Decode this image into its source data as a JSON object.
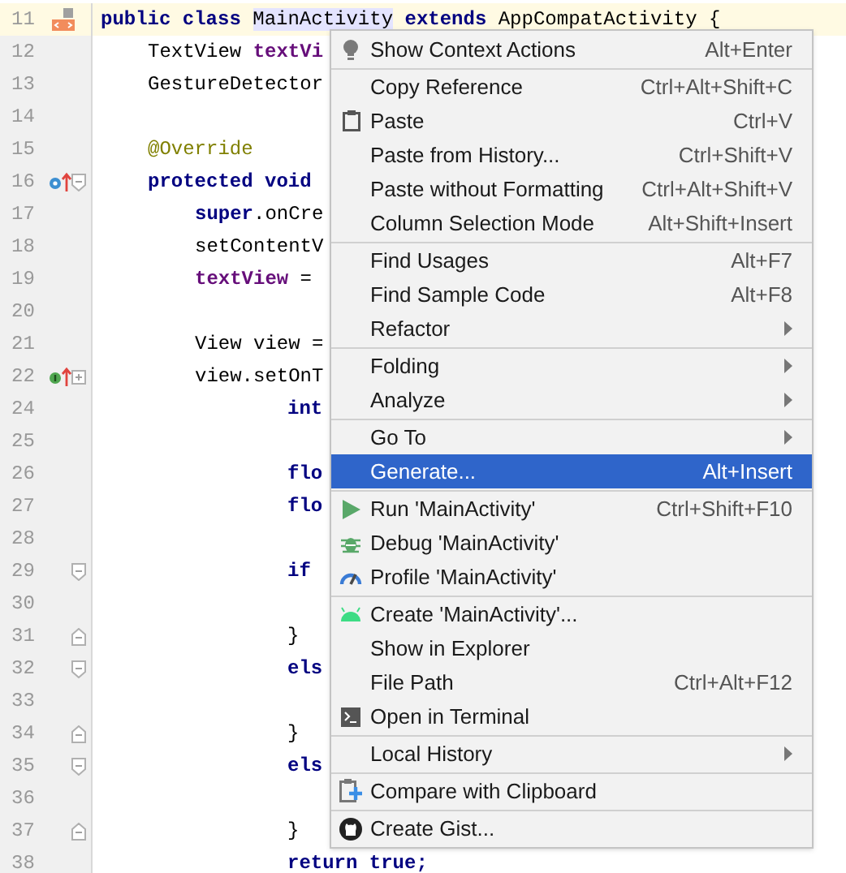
{
  "editor": {
    "lines": [
      {
        "number": "11",
        "current": true,
        "kind": "class",
        "segments": [
          {
            "text": "public class ",
            "kind": "keyword"
          },
          {
            "text": "MainActivity",
            "kind": "highlight"
          },
          {
            "text": " extends",
            "kind": "keyword"
          },
          {
            "text": " AppCompatActivity {",
            "kind": "plain"
          }
        ],
        "children": [
          {
            "number": "12",
            "current": false,
            "kind": "code",
            "segments": [
              {
                "text": "TextView ",
                "kind": "plain"
              },
              {
                "text": "textVi",
                "kind": "field"
              }
            ]
          },
          {
            "number": "13",
            "current": false,
            "kind": "code",
            "segments": [
              {
                "text": "GestureDetector",
                "kind": "plain"
              }
            ]
          },
          {
            "number": "14",
            "current": false,
            "kind": "code"
          },
          {
            "number": "15",
            "current": false,
            "kind": "code",
            "segments": [
              {
                "text": "@Override",
                "kind": "annotation"
              }
            ]
          },
          {
            "number": "16",
            "current": false,
            "kind": "override",
            "expanded": true,
            "segments": [
              {
                "text": "protected void",
                "kind": "keyword"
              }
            ],
            "children": [
              {
                "number": "17",
                "current": false,
                "kind": "code",
                "segments": [
                  {
                    "text": "super",
                    "kind": "keyword"
                  },
                  {
                    "text": ".onCre",
                    "kind": "plain"
                  }
                ]
              },
              {
                "number": "18",
                "current": false,
                "kind": "code",
                "segments": [
                  {
                    "text": "setContentV",
                    "kind": "plain"
                  }
                ]
              },
              {
                "number": "19",
                "current": false,
                "kind": "code",
                "segments": [
                  {
                    "text": "textView",
                    "kind": "field"
                  },
                  {
                    "text": " =",
                    "kind": "plain"
                  }
                ]
              },
              {
                "number": "20",
                "current": false,
                "kind": "code"
              },
              {
                "number": "21",
                "current": false,
                "kind": "code",
                "segments": [
                  {
                    "text": "View view =",
                    "kind": "plain"
                  }
                ]
              },
              {
                "number": "22",
                "current": false,
                "kind": "implement",
                "expanded": false,
                "segments": [
                  {
                    "text": "view.setOnT",
                    "kind": "plain"
                  }
                ],
                "children": [
                  {
                    "number": "24",
                    "current": false,
                    "kind": "code",
                    "segments": [
                      {
                        "text": "int",
                        "kind": "keyword"
                      }
                    ]
                  },
                  {
                    "number": "25",
                    "current": false,
                    "kind": "code"
                  },
                  {
                    "number": "26",
                    "current": false,
                    "kind": "code",
                    "segments": [
                      {
                        "text": "flo",
                        "kind": "keyword"
                      }
                    ]
                  },
                  {
                    "number": "27",
                    "current": false,
                    "kind": "code",
                    "segments": [
                      {
                        "text": "flo",
                        "kind": "keyword"
                      }
                    ]
                  },
                  {
                    "number": "28",
                    "current": false,
                    "kind": "code"
                  },
                  {
                    "number": "29",
                    "current": false,
                    "kind": "code",
                    "expanded": true,
                    "segments": [
                      {
                        "text": "if",
                        "kind": "keyword"
                      }
                    ]
                  },
                  {
                    "number": "30",
                    "current": false,
                    "kind": "code"
                  },
                  {
                    "number": "31",
                    "current": false,
                    "kind": "block_end",
                    "segments": [
                      {
                        "text": "}",
                        "kind": "plain"
                      }
                    ]
                  },
                  {
                    "number": "32",
                    "current": false,
                    "kind": "code",
                    "expanded": true,
                    "segments": [
                      {
                        "text": "els",
                        "kind": "keyword"
                      }
                    ]
                  },
                  {
                    "number": "33",
                    "current": false,
                    "kind": "code"
                  },
                  {
                    "number": "34",
                    "current": false,
                    "kind": "block_end",
                    "segments": [
                      {
                        "text": "}",
                        "kind": "plain"
                      }
                    ]
                  },
                  {
                    "number": "35",
                    "current": false,
                    "kind": "code",
                    "expanded": true,
                    "segments": [
                      {
                        "text": "els",
                        "kind": "keyword"
                      }
                    ]
                  },
                  {
                    "number": "36",
                    "current": false,
                    "kind": "code"
                  },
                  {
                    "number": "37",
                    "current": false,
                    "kind": "block_end",
                    "segments": [
                      {
                        "text": "}",
                        "kind": "plain"
                      }
                    ]
                  },
                  {
                    "number": "38",
                    "current": false,
                    "kind": "code",
                    "segments": [
                      {
                        "text": "return true;",
                        "kind": "keyword"
                      }
                    ]
                  }
                ]
              }
            ]
          }
        ]
      }
    ]
  },
  "context_menu": {
    "groups": [
      [
        {
          "label": "Show Context Actions",
          "shortcut": "Alt+Enter",
          "kind": "bulb",
          "submenu": false,
          "selected": false
        }
      ],
      [
        {
          "label": "Copy Reference",
          "shortcut": "Ctrl+Alt+Shift+C",
          "kind": "text",
          "submenu": false,
          "selected": false
        },
        {
          "label": "Paste",
          "shortcut": "Ctrl+V",
          "kind": "clipboard",
          "submenu": false,
          "selected": false
        },
        {
          "label": "Paste from History...",
          "shortcut": "Ctrl+Shift+V",
          "kind": "text",
          "submenu": false,
          "selected": false
        },
        {
          "label": "Paste without Formatting",
          "shortcut": "Ctrl+Alt+Shift+V",
          "kind": "text",
          "submenu": false,
          "selected": false
        },
        {
          "label": "Column Selection Mode",
          "shortcut": "Alt+Shift+Insert",
          "kind": "text",
          "submenu": false,
          "selected": false
        }
      ],
      [
        {
          "label": "Find Usages",
          "shortcut": "Alt+F7",
          "kind": "text",
          "submenu": false,
          "selected": false
        },
        {
          "label": "Find Sample Code",
          "shortcut": "Alt+F8",
          "kind": "text",
          "submenu": false,
          "selected": false
        },
        {
          "label": "Refactor",
          "kind": "text",
          "submenu": true,
          "selected": false
        }
      ],
      [
        {
          "label": "Folding",
          "kind": "text",
          "submenu": true,
          "selected": false
        },
        {
          "label": "Analyze",
          "kind": "text",
          "submenu": true,
          "selected": false
        }
      ],
      [
        {
          "label": "Go To",
          "kind": "text",
          "submenu": true,
          "selected": false
        },
        {
          "label": "Generate...",
          "shortcut": "Alt+Insert",
          "kind": "text",
          "submenu": false,
          "selected": true
        }
      ],
      [
        {
          "label": "Run 'MainActivity'",
          "shortcut": "Ctrl+Shift+F10",
          "kind": "run",
          "submenu": false,
          "selected": false
        },
        {
          "label": "Debug 'MainActivity'",
          "kind": "debug",
          "submenu": false,
          "selected": false
        },
        {
          "label": "Profile 'MainActivity'",
          "kind": "profile",
          "submenu": false,
          "selected": false
        }
      ],
      [
        {
          "label": "Create 'MainActivity'...",
          "kind": "android",
          "submenu": false,
          "selected": false
        },
        {
          "label": "Show in Explorer",
          "kind": "text",
          "submenu": false,
          "selected": false
        },
        {
          "label": "File Path",
          "shortcut": "Ctrl+Alt+F12",
          "kind": "text",
          "submenu": false,
          "selected": false
        },
        {
          "label": "Open in Terminal",
          "kind": "terminal",
          "submenu": false,
          "selected": false
        }
      ],
      [
        {
          "label": "Local History",
          "kind": "text",
          "submenu": true,
          "selected": false
        }
      ],
      [
        {
          "label": "Compare with Clipboard",
          "kind": "compare",
          "submenu": false,
          "selected": false
        }
      ],
      [
        {
          "label": "Create Gist...",
          "kind": "gist",
          "submenu": false,
          "selected": false
        }
      ]
    ]
  }
}
